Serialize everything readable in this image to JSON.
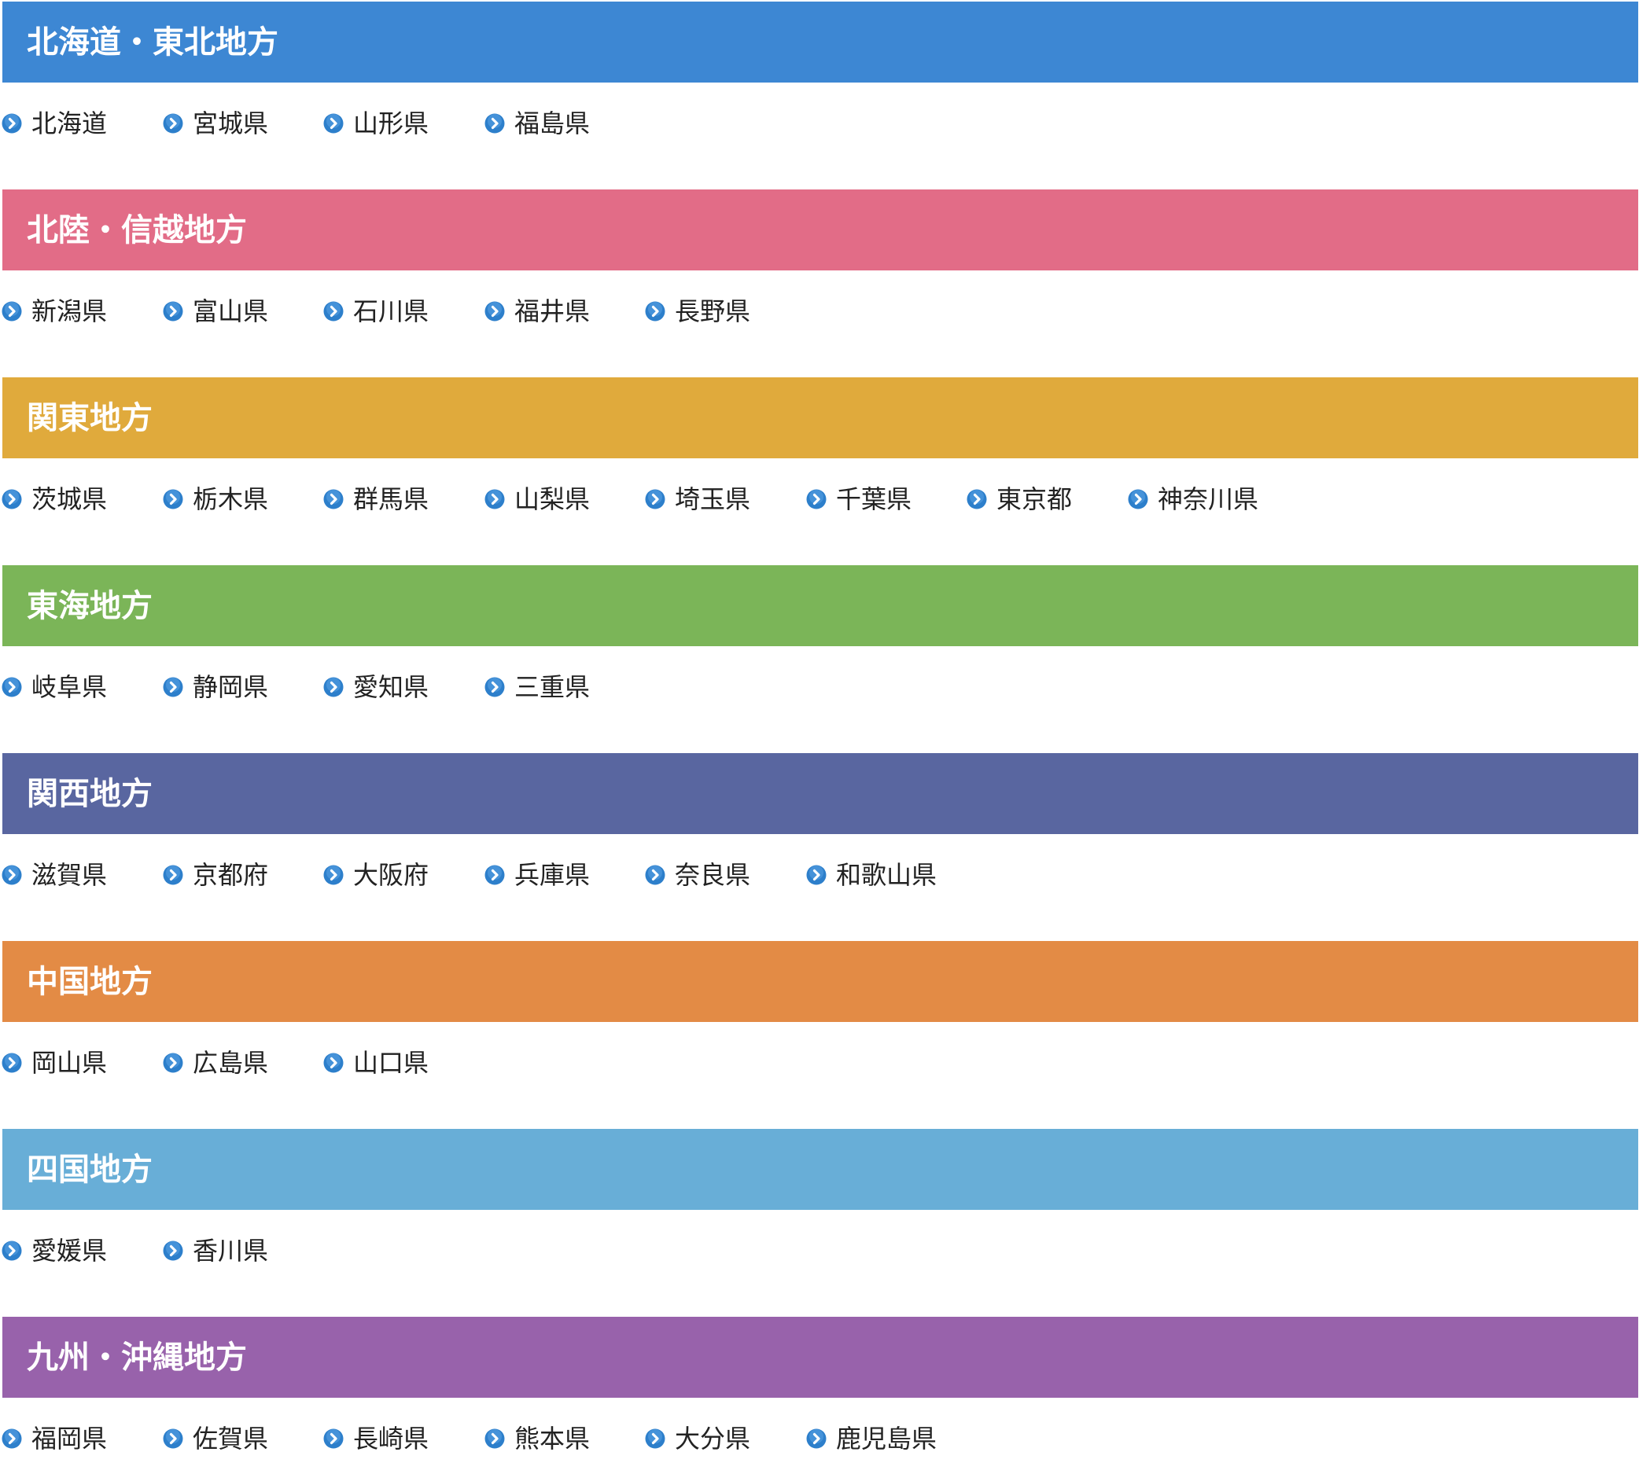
{
  "icon": "chevron-right-circle-icon",
  "regions": [
    {
      "id": "hokkaido-tohoku",
      "title": "北海道・東北地方",
      "color": "#3d87d3",
      "prefectures": [
        "北海道",
        "宮城県",
        "山形県",
        "福島県"
      ]
    },
    {
      "id": "hokuriku-shinetsu",
      "title": "北陸・信越地方",
      "color": "#e26c87",
      "prefectures": [
        "新潟県",
        "富山県",
        "石川県",
        "福井県",
        "長野県"
      ]
    },
    {
      "id": "kanto",
      "title": "関東地方",
      "color": "#e0aa3c",
      "prefectures": [
        "茨城県",
        "栃木県",
        "群馬県",
        "山梨県",
        "埼玉県",
        "千葉県",
        "東京都",
        "神奈川県"
      ]
    },
    {
      "id": "tokai",
      "title": "東海地方",
      "color": "#7bb558",
      "prefectures": [
        "岐阜県",
        "静岡県",
        "愛知県",
        "三重県"
      ]
    },
    {
      "id": "kansai",
      "title": "関西地方",
      "color": "#5966a0",
      "prefectures": [
        "滋賀県",
        "京都府",
        "大阪府",
        "兵庫県",
        "奈良県",
        "和歌山県"
      ]
    },
    {
      "id": "chugoku",
      "title": "中国地方",
      "color": "#e38b45",
      "prefectures": [
        "岡山県",
        "広島県",
        "山口県"
      ]
    },
    {
      "id": "shikoku",
      "title": "四国地方",
      "color": "#68aed7",
      "prefectures": [
        "愛媛県",
        "香川県"
      ]
    },
    {
      "id": "kyushu-okinawa",
      "title": "九州・沖縄地方",
      "color": "#9862ab",
      "prefectures": [
        "福岡県",
        "佐賀県",
        "長崎県",
        "熊本県",
        "大分県",
        "鹿児島県"
      ]
    }
  ]
}
